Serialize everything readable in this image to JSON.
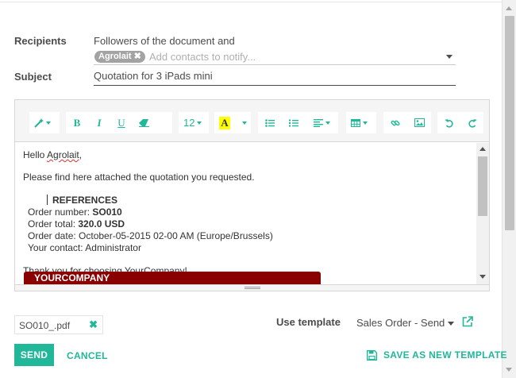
{
  "form": {
    "recipients_label": "Recipients",
    "recipients_text": "Followers of the document and",
    "recipient_tag": "Agrolait",
    "recipient_tag_remove": "✖",
    "contacts_placeholder": "Add contacts to notify...",
    "subject_label": "Subject",
    "subject_value": "Quotation for 3 iPads mini"
  },
  "toolbar": {
    "font_size": "12",
    "icons": [
      "magic-wand-icon",
      "bold-icon",
      "italic-icon",
      "underline-icon",
      "eraser-icon",
      "font-size-select",
      "text-color-icon",
      "unordered-list-icon",
      "ordered-list-icon",
      "paragraph-align-icon",
      "table-icon",
      "link-icon",
      "picture-icon",
      "undo-icon",
      "redo-icon"
    ],
    "accent_color": "#21b799",
    "bold": "B",
    "italic": "I",
    "underline": "U",
    "color_letter": "A"
  },
  "body": {
    "greeting_prefix": "Hello ",
    "greeting_name": "Agrolait",
    "greeting_suffix": ",",
    "intro": "Please find here attached the quotation you requested.",
    "references_title": "REFERENCES",
    "order_number_label": "Order number: ",
    "order_number": "SO010",
    "order_total_label": "Order total: ",
    "order_total": "320.0 USD",
    "order_date_label": "Order date: ",
    "order_date": "October-05-2015 02-00 AM (Europe/Brussels)",
    "contact_label": "Your contact: ",
    "contact": "Administrator",
    "thanks": "Thank you for choosing YourCompany!",
    "company_banner": "YOURCOMPANY",
    "banner_color": "#8a0000"
  },
  "attachment": {
    "filename": "SO010_.pdf",
    "remove_icon": "✖"
  },
  "template": {
    "label": "Use template",
    "selected": "Sales Order - Send"
  },
  "footer": {
    "send": "SEND",
    "cancel": "CANCEL",
    "save_as_template": "SAVE AS NEW TEMPLATE"
  }
}
